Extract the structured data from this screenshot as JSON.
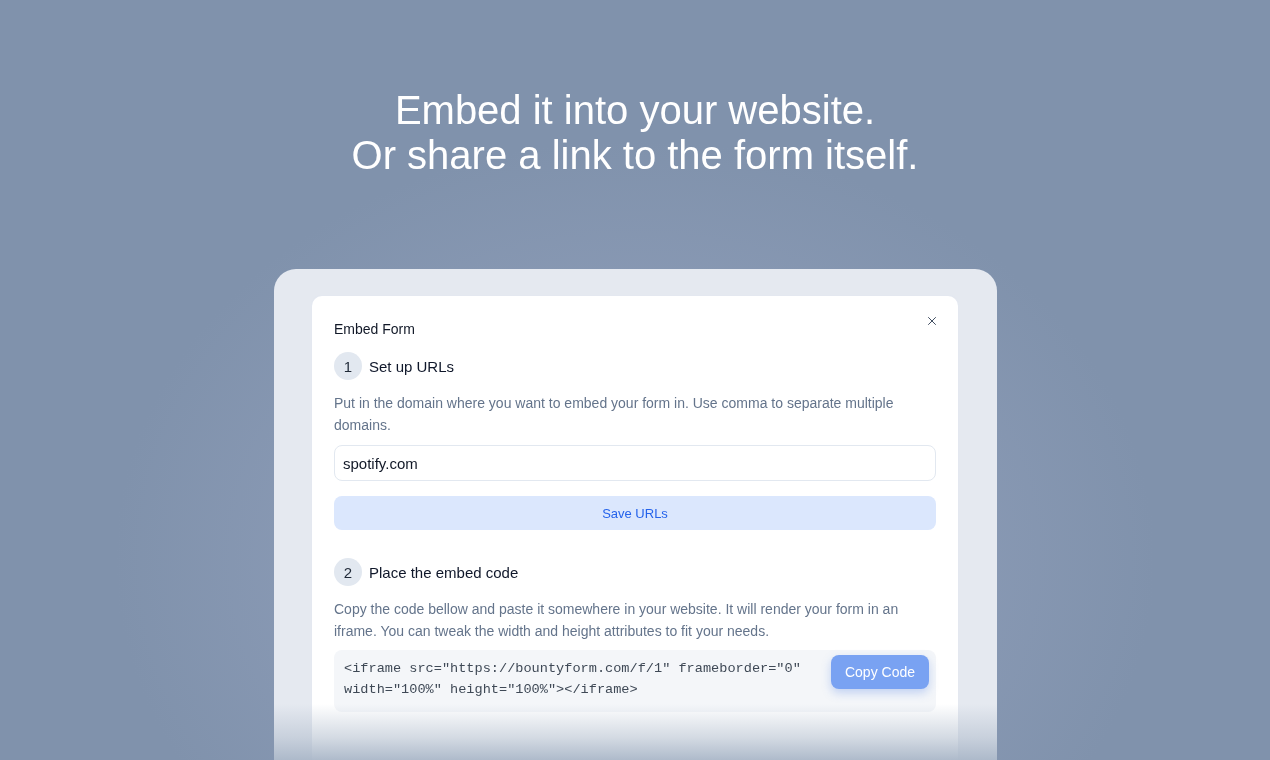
{
  "headline": {
    "lines": [
      "Embed it into your website.",
      "Or share a link to the form itself."
    ]
  },
  "modal": {
    "title": "Embed Form",
    "steps": [
      {
        "kind": "url-input",
        "number": "1",
        "title": "Set up URLs",
        "description": "Put in the domain where you want to embed your form in. Use comma to separate multiple domains.",
        "input": {
          "value": "spotify.com"
        },
        "button": "Save URLs"
      },
      {
        "kind": "code",
        "number": "2",
        "title": "Place the embed code",
        "description": "Copy the code bellow and paste it somewhere in your website. It will render your form in an iframe. You can tweak the width and height attributes to fit your needs.",
        "code": "<iframe src=\"https://bountyform.com/f/1\" frameborder=\"0\" width=\"100%\" height=\"100%\"></iframe>",
        "button": "Copy Code"
      }
    ]
  }
}
